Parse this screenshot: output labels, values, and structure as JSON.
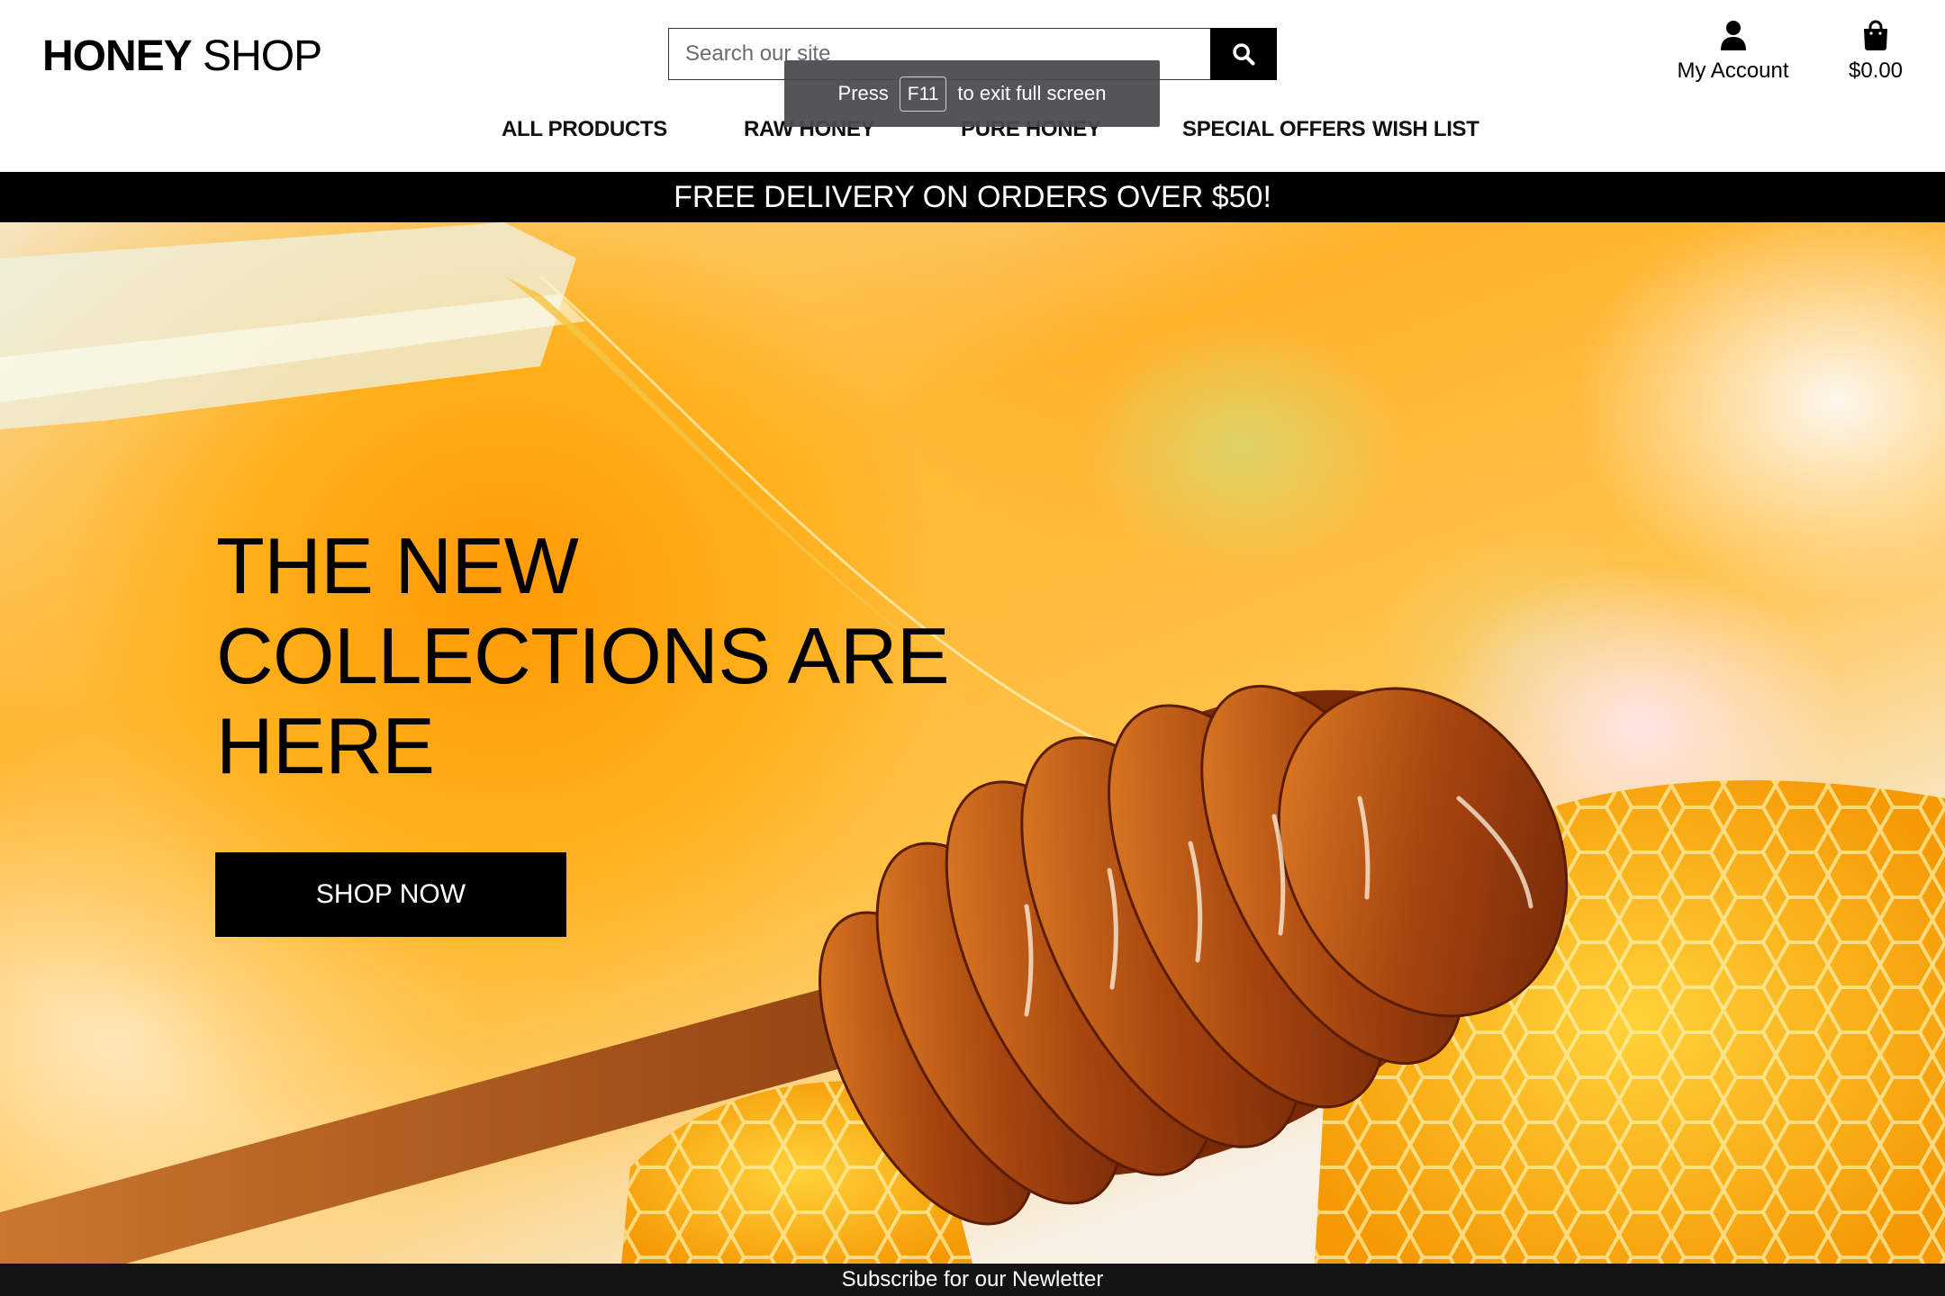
{
  "brand": {
    "bold": "HONEY",
    "regular": "SHOP"
  },
  "search": {
    "placeholder": "Search our site",
    "icon": "search-icon"
  },
  "account": {
    "label": "My Account",
    "icon": "user-icon"
  },
  "bag": {
    "total": "$0.00",
    "icon": "shopping-bag-icon"
  },
  "nav": {
    "items": [
      {
        "label": "ALL PRODUCTS"
      },
      {
        "label": "RAW HONEY"
      },
      {
        "label": "PURE HONEY"
      },
      {
        "label": "SPECIAL OFFERS"
      },
      {
        "label": "WISH LIST"
      }
    ]
  },
  "fullscreen_toast": {
    "prefix": "Press",
    "key": "F11",
    "suffix": "to exit full screen"
  },
  "banner": {
    "text": "FREE DELIVERY ON ORDERS OVER $50!"
  },
  "hero": {
    "title": "THE NEW COLLECTIONS ARE HERE",
    "cta_label": "SHOP NOW"
  },
  "footer": {
    "subscribe_text": "Subscribe for our Newletter"
  },
  "colors": {
    "black": "#000000",
    "white": "#ffffff",
    "honey": "#ffa41a",
    "toast_bg": "#484a4e"
  }
}
